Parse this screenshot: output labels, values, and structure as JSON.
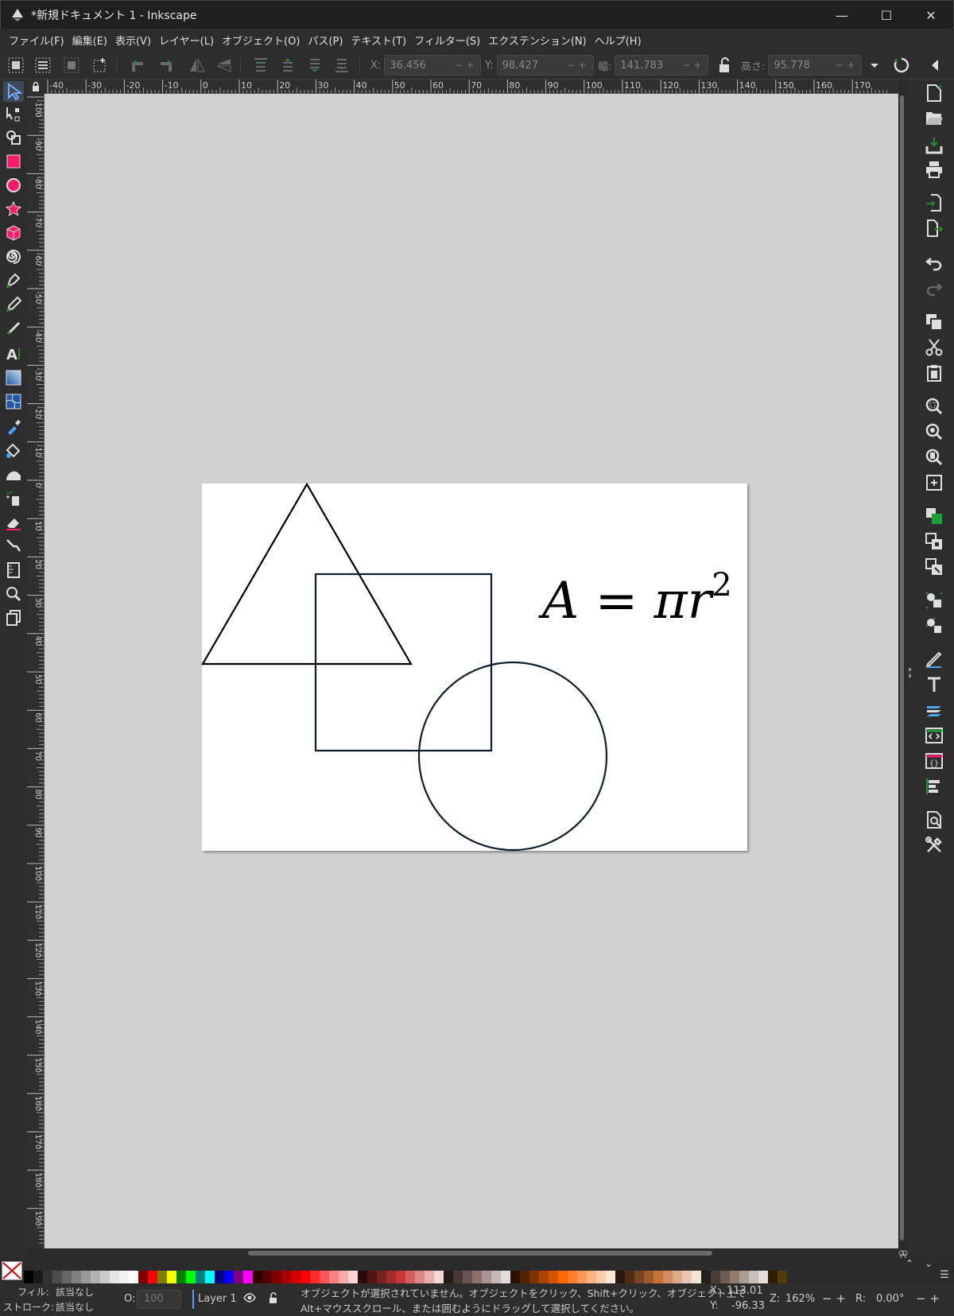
{
  "window": {
    "title": "*新規ドキュメント 1 - Inkscape",
    "minimize_glyph": "—",
    "maximize_glyph": "☐",
    "close_glyph": "✕"
  },
  "menu": [
    "ファイル(F)",
    "編集(E)",
    "表示(V)",
    "レイヤー(L)",
    "オブジェクト(O)",
    "パス(P)",
    "テキスト(T)",
    "フィルター(S)",
    "エクステンション(N)",
    "ヘルプ(H)"
  ],
  "toolbar": {
    "x_label": "X:",
    "x_value": "36.456",
    "y_label": "Y:",
    "y_value": "98.427",
    "w_label": "幅:",
    "w_value": "141.783",
    "h_label": "高さ:",
    "h_value": "95.778",
    "pm": "−+"
  },
  "rulers": {
    "h_ticks": [
      "-40",
      "-30",
      "-20",
      "-10",
      "0",
      "10",
      "20",
      "30",
      "40",
      "50",
      "60",
      "70",
      "80",
      "90",
      "100",
      "110",
      "120",
      "130",
      "140",
      "150",
      "160",
      "170"
    ],
    "v_ticks": [
      "-100",
      "-90",
      "-80",
      "-70",
      "-60",
      "-50",
      "-40",
      "-30",
      "-20",
      "-10",
      "0",
      "10",
      "20",
      "30",
      "40",
      "50",
      "60",
      "70",
      "80",
      "90",
      "100",
      "110",
      "120",
      "130",
      "140",
      "150",
      "160",
      "170",
      "180",
      "190"
    ]
  },
  "drawing": {
    "formula_main": "A = πr",
    "formula_sup": "2"
  },
  "palette": {
    "colors": [
      "#000000",
      "#1a1a1a",
      "#333333",
      "#4d4d4d",
      "#666666",
      "#808080",
      "#999999",
      "#b3b3b3",
      "#cccccc",
      "#e6e6e6",
      "#f2f2f2",
      "#ffffff",
      "#800000",
      "#ff0000",
      "#808000",
      "#ffff00",
      "#008000",
      "#00ff00",
      "#008080",
      "#00ffff",
      "#000080",
      "#0000ff",
      "#800080",
      "#ff00ff",
      "#2b0000",
      "#550000",
      "#800000",
      "#aa0000",
      "#d40000",
      "#ff0000",
      "#ff2a2a",
      "#ff5555",
      "#ff8080",
      "#ffaaaa",
      "#ffd5d5",
      "#280b0b",
      "#501616",
      "#782121",
      "#a02c2c",
      "#c83737",
      "#d35f5f",
      "#de8787",
      "#e9afaf",
      "#f4d7d7",
      "#241c1c",
      "#483737",
      "#6c5353",
      "#916f6f",
      "#ac9393",
      "#c8b7b7",
      "#e3dbdb",
      "#2b1100",
      "#552200",
      "#803300",
      "#aa4400",
      "#d45500",
      "#ff6600",
      "#ff7f2a",
      "#ff9955",
      "#ffb380",
      "#ffccaa",
      "#ffe6d5",
      "#28170b",
      "#502d16",
      "#784421",
      "#a05a2c",
      "#c87137",
      "#d38d5f",
      "#deaa87",
      "#e9c6af",
      "#f4e3d7",
      "#241f1c",
      "#483e37",
      "#6c5d53",
      "#917c6f",
      "#ac9d93",
      "#c8beb7",
      "#e3dedb",
      "#2b1f00",
      "#553d00"
    ]
  },
  "status": {
    "fill_label": "フィル:",
    "fill_value": "該当なし",
    "stroke_label": "ストローク:",
    "stroke_value": "該当なし",
    "opacity_label": "O:",
    "opacity_value": "100",
    "layer": "Layer 1",
    "message_line1": "オブジェクトが選択されていません。オブジェクトをクリック、Shift+クリック、オブジェクト上で",
    "message_line2": "Alt+マウススクロール、または囲むようにドラッグして選択してください。",
    "cursor_x_label": "X:",
    "cursor_x": "113.01",
    "cursor_y_label": "Y:",
    "cursor_y": "-96.33",
    "zoom_label": "Z:",
    "zoom": "162%",
    "rotate_label": "R:",
    "rotate": "0.00°"
  }
}
